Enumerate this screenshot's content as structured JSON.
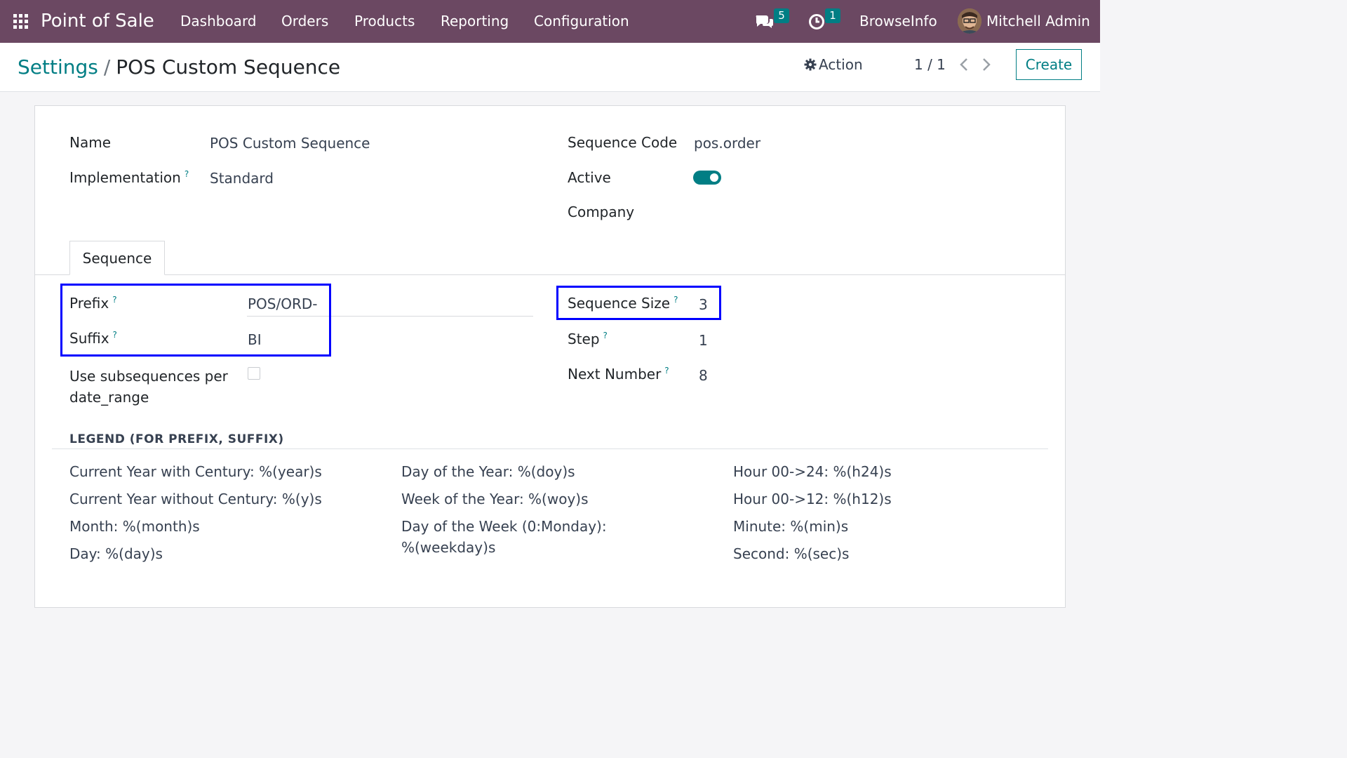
{
  "navbar": {
    "app_title": "Point of Sale",
    "menu": [
      "Dashboard",
      "Orders",
      "Products",
      "Reporting",
      "Configuration"
    ],
    "messages_badge": "5",
    "activities_badge": "1",
    "company": "BrowseInfo",
    "user": "Mitchell Admin",
    "icons": [
      "apps-grid-icon",
      "chat-bubbles-icon",
      "clock-activity-icon",
      "user-avatar"
    ]
  },
  "control_panel": {
    "breadcrumb_parent": "Settings",
    "breadcrumb_sep": "/",
    "breadcrumb_current": "POS Custom Sequence",
    "action_label": "Action",
    "pager": "1 / 1",
    "create_label": "Create"
  },
  "form": {
    "name_label": "Name",
    "name_value": "POS Custom Sequence",
    "implementation_label": "Implementation",
    "implementation_value": "Standard",
    "sequence_code_label": "Sequence Code",
    "sequence_code_value": "pos.order",
    "active_label": "Active",
    "active_value": true,
    "company_label": "Company",
    "company_value": "",
    "help_mark": "?"
  },
  "tabs": [
    "Sequence"
  ],
  "sequence_tab": {
    "prefix_label": "Prefix",
    "prefix_value": "POS/ORD-",
    "suffix_label": "Suffix",
    "suffix_value": "BI",
    "subseq_label_line1": "Use subsequences per",
    "subseq_label_line2": "date_range",
    "subseq_checked": false,
    "size_label": "Sequence Size",
    "size_value": "3",
    "step_label": "Step",
    "step_value": "1",
    "next_label": "Next Number",
    "next_value": "8"
  },
  "legend": {
    "title": "LEGEND (FOR PREFIX, SUFFIX)",
    "col1": [
      "Current Year with Century: %(year)s",
      "Current Year without Century: %(y)s",
      "Month: %(month)s",
      "Day: %(day)s"
    ],
    "col2": [
      "Day of the Year: %(doy)s",
      "Week of the Year: %(woy)s",
      "Day of the Week (0:Monday):",
      "%(weekday)s"
    ],
    "col3": [
      "Hour 00->24: %(h24)s",
      "Hour 00->12: %(h12)s",
      "Minute: %(min)s",
      "Second: %(sec)s"
    ]
  },
  "colors": {
    "navbar": "#6b4862",
    "accent": "#017e84",
    "highlight_box": "#0000ff"
  }
}
